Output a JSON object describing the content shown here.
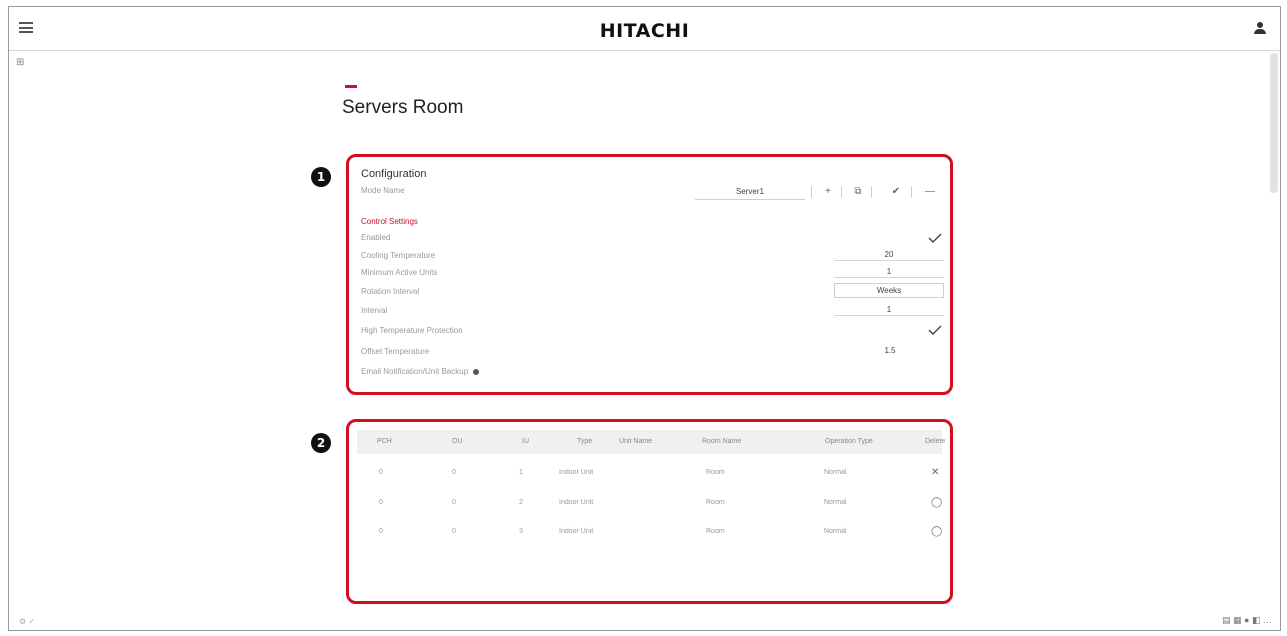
{
  "header": {
    "brand": "HITACHI",
    "menu_icon": "menu-icon",
    "user_icon": "user-icon"
  },
  "page": {
    "title": "Servers Room"
  },
  "callouts": {
    "one": "1",
    "two": "2"
  },
  "configuration": {
    "title": "Configuration",
    "mode_label": "Mode Name",
    "mode_value": "Server1",
    "toolbar": {
      "add": "+",
      "copy": "⧉",
      "apply": "✔",
      "remove": "—"
    },
    "section_label": "Control Settings",
    "rows": [
      {
        "label": "Enabled",
        "kind": "check",
        "value": "✓"
      },
      {
        "label": "Cooling Temperature",
        "kind": "field",
        "value": "20"
      },
      {
        "label": "Minimum Active Units",
        "kind": "field",
        "value": "1"
      },
      {
        "label": "Rotation Interval",
        "kind": "boxed",
        "value": "Weeks"
      },
      {
        "label": "Interval",
        "kind": "field",
        "value": "1"
      },
      {
        "label": "High Temperature Protection",
        "kind": "check",
        "value": "✓"
      },
      {
        "label": "Offset Temperature",
        "kind": "plain",
        "value": "1.5"
      },
      {
        "label": "Email Notification/Unit Backup",
        "kind": "info",
        "value": ""
      }
    ]
  },
  "units_table": {
    "headers": [
      "PCH",
      "OU",
      "IU",
      "Type",
      "Unit Name",
      "Room Name",
      "Operation Type",
      "Delete"
    ],
    "rows": [
      {
        "pch": "0",
        "ou": "0",
        "iu": "1",
        "type": "Indoor Unit",
        "unit_name": "",
        "room_name": "Room",
        "operation_type": "Normal",
        "delete": "✕"
      },
      {
        "pch": "0",
        "ou": "0",
        "iu": "2",
        "type": "Indoor Unit",
        "unit_name": "",
        "room_name": "Room",
        "operation_type": "Normal",
        "delete": "◯"
      },
      {
        "pch": "0",
        "ou": "0",
        "iu": "3",
        "type": "Indoor Unit",
        "unit_name": "",
        "room_name": "Room",
        "operation_type": "Normal",
        "delete": "◯"
      }
    ]
  },
  "footer": {
    "left": "⚙ ✓",
    "right": "▤ ▦ ● ◧ …"
  },
  "colors": {
    "accent": "#c8102e",
    "callout_border": "#d0101f"
  }
}
